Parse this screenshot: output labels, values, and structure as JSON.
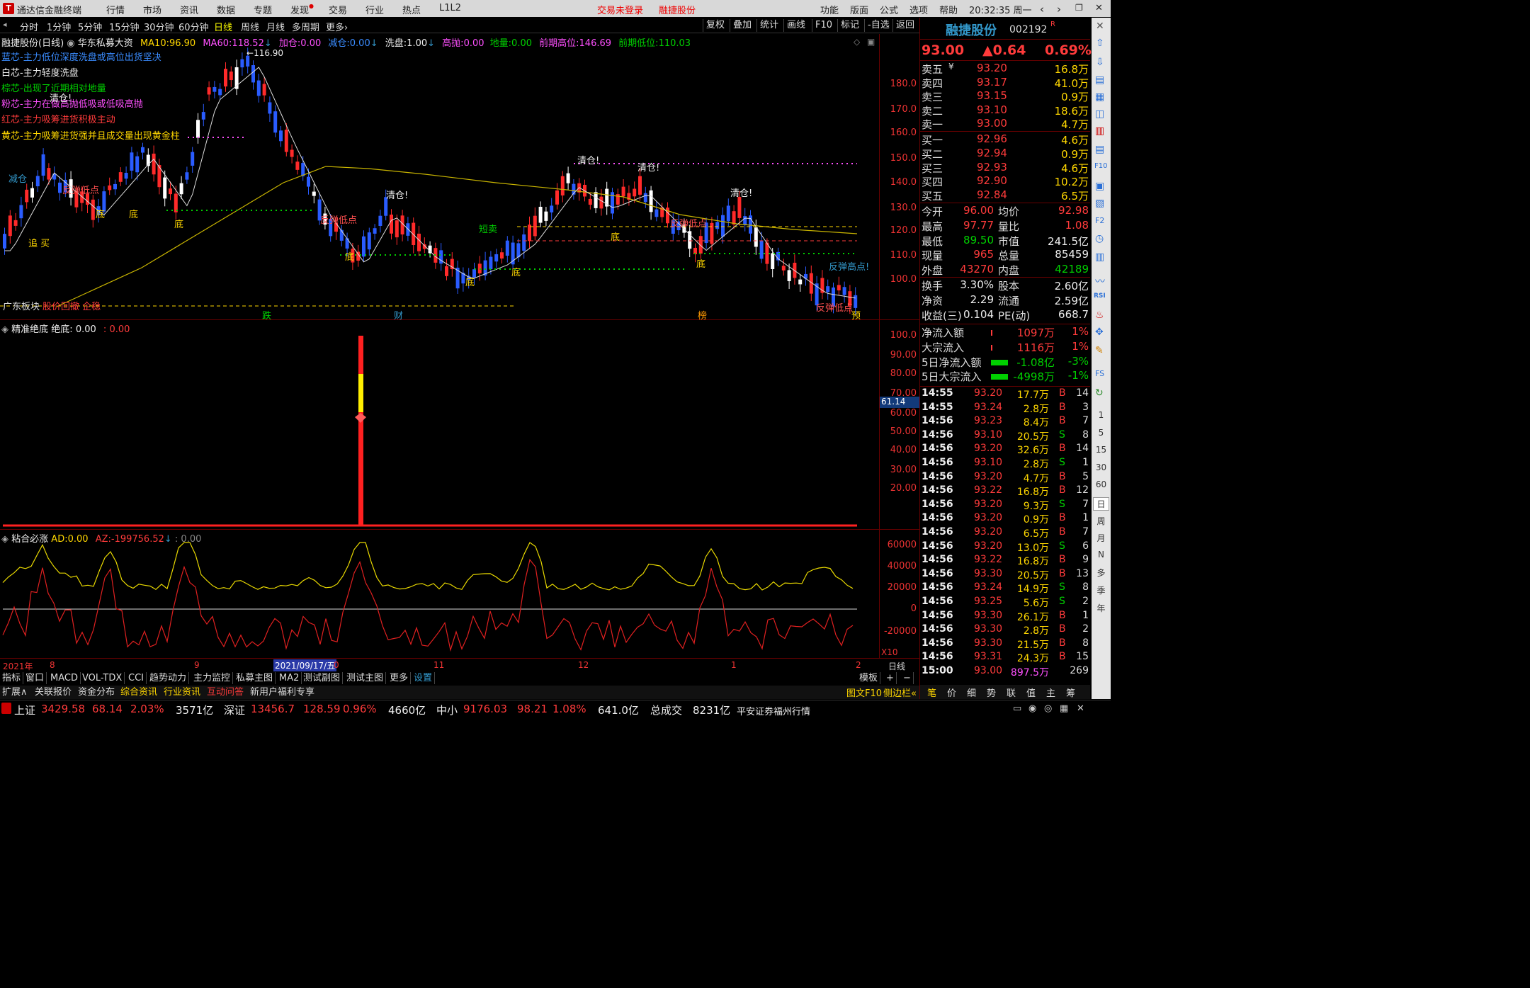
{
  "app": {
    "title": "通达信金融终端",
    "menus": [
      "行情",
      "市场",
      "资讯",
      "数据",
      "专题",
      "发现",
      "交易",
      "行业",
      "热点",
      "L1L2"
    ],
    "login_status": "交易未登录",
    "stock_short": "融捷股份",
    "right_menus": [
      "功能",
      "版面",
      "公式",
      "选项",
      "帮助"
    ],
    "clock": "20:32:35 周一"
  },
  "period_tabs": [
    "分时",
    "1分钟",
    "5分钟",
    "15分钟",
    "30分钟",
    "60分钟",
    "日线",
    "周线",
    "月线",
    "多周期",
    "更多"
  ],
  "right_toolbar": [
    "复权",
    "叠加",
    "统计",
    "画线",
    "F10",
    "标记",
    "-自选",
    "返回"
  ],
  "chart_header": {
    "name": "融捷股份(日线)",
    "indicator": "华东私募大资",
    "ma10_label": "MA10:",
    "ma10": "96.90",
    "ma60_label": "MA60:",
    "ma60": "118.52",
    "jc_label": "加仓:",
    "jc": "0.00",
    "jian_label": "减仓:",
    "jian": "0.00",
    "xp_label": "洗盘:",
    "xp": "1.00",
    "gp_label": "高抛:",
    "gp": "0.00",
    "dx_label": "地量:",
    "dx": "0.00",
    "qh_label": "前期高位:",
    "qh": "146.69",
    "ql_label": "前期低位:",
    "ql": "110.03",
    "peak_label": "116.90"
  },
  "legend_notes": [
    {
      "text": "蓝芯-主力低位深度洗盘或高位出货坚决",
      "color": "#3a8cff"
    },
    {
      "text": "白芯-主力轻度洗盘",
      "color": "#eeeeee"
    },
    {
      "text": "棕芯-出现了近期相对地量",
      "color": "#00d000"
    },
    {
      "text": "粉芯-主力在做高抛低吸或低吸高抛",
      "color": "#ff50ff"
    },
    {
      "text": "红芯-主力吸筹进货积极主动",
      "color": "#ff3b3b"
    },
    {
      "text": "黄芯-主力吸筹进货强并且成交量出现黄金柱",
      "color": "#ffd700"
    }
  ],
  "chart_annotations": [
    {
      "text": "减仓",
      "color": "#39c"
    },
    {
      "text": "反弹低点",
      "color": "#ff5050"
    },
    {
      "text": "清仓!",
      "color": "#eeeeee"
    },
    {
      "text": "底",
      "color": "#ffd700"
    },
    {
      "text": "追 买",
      "color": "#ffd700"
    },
    {
      "text": "短卖",
      "color": "#00d000"
    },
    {
      "text": "反弹高点!",
      "color": "#39c"
    },
    {
      "text": "广东板块",
      "color": "#dddddd"
    },
    {
      "text": "跌",
      "color": "#00d000"
    },
    {
      "text": "财",
      "color": "#39c"
    },
    {
      "text": "榜",
      "color": "#ff9900"
    },
    {
      "text": "预",
      "color": "#ffd700"
    },
    {
      "text": "股价回撤  企稳",
      "color": "#ff3b3b"
    }
  ],
  "main_yaxis": [
    "180.0",
    "170.0",
    "160.0",
    "150.0",
    "140.0",
    "130.0",
    "120.0",
    "110.0",
    "100.0"
  ],
  "ind1": {
    "name": "精准绝底",
    "label": "绝底:",
    "value": "0.00",
    "value2": "0.00",
    "yaxis": [
      "100.0",
      "90.00",
      "80.00",
      "70.00",
      "60.00",
      "50.00",
      "40.00",
      "30.00",
      "20.00"
    ],
    "marker": "61.14"
  },
  "ind2": {
    "name": "粘合必涨",
    "ad_label": "AD:",
    "ad": "0.00",
    "az_label": "AZ:",
    "az": "-199756.52",
    "extra": ": 0.00",
    "yaxis": [
      "60000",
      "40000",
      "20000",
      "0",
      "-20000"
    ],
    "scale": "X10"
  },
  "xaxis": {
    "labels": [
      "2021年",
      "8",
      "9",
      "2021/09/17/五",
      "0",
      "11",
      "12",
      "1",
      "2"
    ],
    "mode": "日线"
  },
  "bottom_tabs": [
    "指标",
    "窗口",
    "MACD",
    "VOL-TDX",
    "CCI",
    "趋势动力",
    "主力监控",
    "私募主图",
    "MA2",
    "测试副图",
    "测试主图",
    "更多",
    "设置"
  ],
  "template_tab": "模板",
  "links": [
    {
      "text": "扩展∧",
      "color": "#dddddd"
    },
    {
      "text": "关联报价",
      "color": "#dddddd"
    },
    {
      "text": "资金分布",
      "color": "#dddddd"
    },
    {
      "text": "综合资讯",
      "color": "#ffd700"
    },
    {
      "text": "行业资讯",
      "color": "#ffd700"
    },
    {
      "text": "互动问答",
      "color": "#ff3b3b"
    },
    {
      "text": "新用户福利专享",
      "color": "#dddddd"
    }
  ],
  "quote": {
    "name": "融捷股份",
    "code": "002192",
    "flag": "R",
    "price": "93.00",
    "change": "▲0.64",
    "pct": "0.69%",
    "asks": [
      {
        "l": "卖五",
        "p": "93.20",
        "v": "16.8万",
        "pc": "#ff3b3b"
      },
      {
        "l": "卖四",
        "p": "93.17",
        "v": "41.0万",
        "pc": "#ff3b3b"
      },
      {
        "l": "卖三",
        "p": "93.15",
        "v": "0.9万",
        "pc": "#ff3b3b"
      },
      {
        "l": "卖二",
        "p": "93.10",
        "v": "18.6万",
        "pc": "#ff3b3b"
      },
      {
        "l": "卖一",
        "p": "93.00",
        "v": "4.7万",
        "pc": "#ff3b3b"
      }
    ],
    "bids": [
      {
        "l": "买一",
        "p": "92.96",
        "v": "4.6万",
        "pc": "#ff3b3b"
      },
      {
        "l": "买二",
        "p": "92.94",
        "v": "0.9万",
        "pc": "#ff3b3b"
      },
      {
        "l": "买三",
        "p": "92.93",
        "v": "4.6万",
        "pc": "#ff3b3b"
      },
      {
        "l": "买四",
        "p": "92.90",
        "v": "10.2万",
        "pc": "#ff3b3b"
      },
      {
        "l": "买五",
        "p": "92.84",
        "v": "6.5万",
        "pc": "#ff3b3b"
      }
    ],
    "stats": [
      {
        "a": "今开",
        "av": "96.00",
        "ac": "#ff3b3b",
        "b": "均价",
        "bv": "92.98",
        "bc": "#ff3b3b"
      },
      {
        "a": "最高",
        "av": "97.77",
        "ac": "#ff3b3b",
        "b": "量比",
        "bv": "1.08",
        "bc": "#ff3b3b"
      },
      {
        "a": "最低",
        "av": "89.50",
        "ac": "#00d000",
        "b": "市值",
        "bv": "241.5亿",
        "bc": "#eeeeee"
      },
      {
        "a": "现量",
        "av": "965",
        "ac": "#ff3b3b",
        "b": "总量",
        "bv": "85459",
        "bc": "#eeeeee"
      },
      {
        "a": "外盘",
        "av": "43270",
        "ac": "#ff3b3b",
        "b": "内盘",
        "bv": "42189",
        "bc": "#00d000"
      }
    ],
    "stats2": [
      {
        "a": "换手",
        "av": "3.30%",
        "b": "股本",
        "bv": "2.60亿"
      },
      {
        "a": "净资",
        "av": "2.29",
        "b": "流通",
        "bv": "2.59亿"
      },
      {
        "a": "收益(三)",
        "av": "0.104",
        "b": "PE(动)",
        "bv": "668.7"
      }
    ],
    "flows": [
      {
        "l": "净流入额",
        "v": "1097万",
        "p": "1%",
        "c": "#ff3b3b"
      },
      {
        "l": "大宗流入",
        "v": "1116万",
        "p": "1%",
        "c": "#ff3b3b"
      },
      {
        "l": "5日净流入额",
        "v": "-1.08亿",
        "p": "-3%",
        "c": "#00d000"
      },
      {
        "l": "5日大宗流入",
        "v": "-4998万",
        "p": "-1%",
        "c": "#00d000"
      }
    ],
    "ticks": [
      [
        "14:55",
        "93.20",
        "17.7万",
        "B",
        "14"
      ],
      [
        "14:55",
        "93.24",
        "2.8万",
        "B",
        "3"
      ],
      [
        "14:56",
        "93.23",
        "8.4万",
        "B",
        "7"
      ],
      [
        "14:56",
        "93.10",
        "20.5万",
        "S",
        "8"
      ],
      [
        "14:56",
        "93.20",
        "32.6万",
        "B",
        "14"
      ],
      [
        "14:56",
        "93.10",
        "2.8万",
        "S",
        "1"
      ],
      [
        "14:56",
        "93.20",
        "4.7万",
        "B",
        "5"
      ],
      [
        "14:56",
        "93.22",
        "16.8万",
        "B",
        "12"
      ],
      [
        "14:56",
        "93.20",
        "9.3万",
        "S",
        "7"
      ],
      [
        "14:56",
        "93.20",
        "0.9万",
        "B",
        "1"
      ],
      [
        "14:56",
        "93.20",
        "6.5万",
        "B",
        "7"
      ],
      [
        "14:56",
        "93.20",
        "13.0万",
        "S",
        "6"
      ],
      [
        "14:56",
        "93.22",
        "16.8万",
        "B",
        "9"
      ],
      [
        "14:56",
        "93.30",
        "20.5万",
        "B",
        "13"
      ],
      [
        "14:56",
        "93.24",
        "14.9万",
        "S",
        "8"
      ],
      [
        "14:56",
        "93.25",
        "5.6万",
        "S",
        "2"
      ],
      [
        "14:56",
        "93.30",
        "26.1万",
        "B",
        "1"
      ],
      [
        "14:56",
        "93.30",
        "2.8万",
        "B",
        "2"
      ],
      [
        "14:56",
        "93.30",
        "21.5万",
        "B",
        "8"
      ],
      [
        "14:56",
        "93.31",
        "24.3万",
        "B",
        "15"
      ],
      [
        "15:00",
        "93.00",
        "897.5万",
        "",
        "269"
      ]
    ],
    "bottom_tabs": [
      "笔",
      "价",
      "细",
      "势",
      "联",
      "值",
      "主",
      "筹"
    ],
    "f10_link": "图文F10",
    "sidebar_link": "侧边栏"
  },
  "side_icons": [
    "1",
    "5",
    "15",
    "30",
    "60",
    "日",
    "周",
    "月",
    "N",
    "多",
    "季",
    "年"
  ],
  "status": {
    "sh_label": "上证",
    "sh": "3429.58",
    "sh_chg": "68.14",
    "sh_pct": "2.03%",
    "sh_amt": "3571亿",
    "sz_label": "深证",
    "sz": "13456.7",
    "sz_chg": "128.59",
    "sz_pct": "0.96%",
    "sz_amt": "4660亿",
    "zx_label": "中小",
    "zx": "9176.03",
    "zx_chg": "98.21",
    "zx_pct": "1.08%",
    "zx_amt": "641.0亿",
    "total_label": "总成交",
    "total": "8231亿",
    "broker": "平安证券福州行情"
  }
}
